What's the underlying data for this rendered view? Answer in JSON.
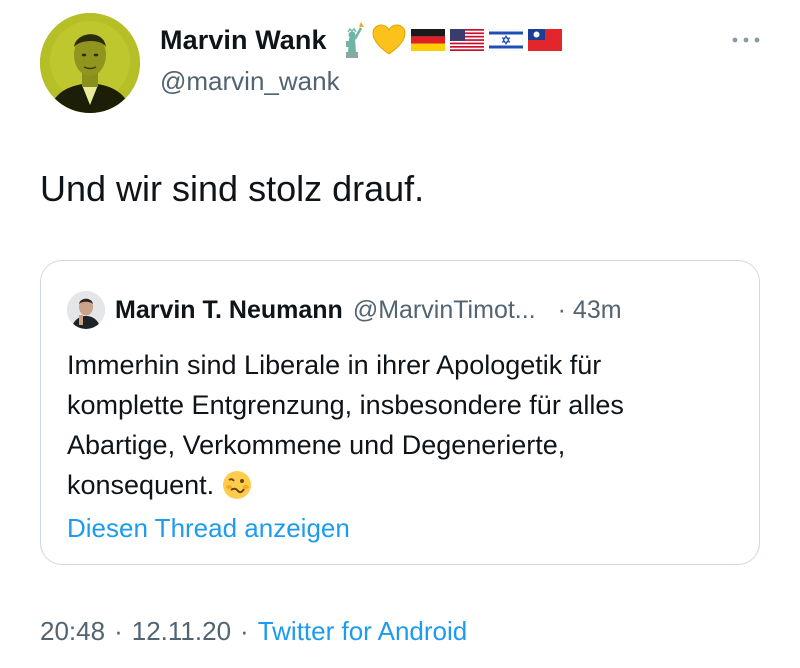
{
  "tweet": {
    "author": {
      "display_name": "Marvin Wank",
      "handle": "@marvin_wank",
      "name_emojis": [
        "statue-of-liberty-icon",
        "yellow-heart-icon",
        "flag-germany-icon",
        "flag-usa-icon",
        "flag-israel-icon",
        "flag-taiwan-icon"
      ]
    },
    "more_icon": "more-horizontal-icon",
    "text": "Und wir sind stolz drauf.",
    "quoted": {
      "display_name": "Marvin T. Neumann",
      "handle": "@MarvinTimot...",
      "time": "· 43m",
      "text_lines": [
        "Immerhin sind Liberale in ihrer Apologetik für",
        "komplette Entgrenzung, insbesondere für alles",
        "Abartige, Verkommene und Degenerierte,",
        "konsequent."
      ],
      "text_emoji": "woozy-face-icon",
      "show_thread_label": "Diesen Thread anzeigen"
    },
    "meta": {
      "time": "20:48",
      "separator": "·",
      "date": "12.11.20",
      "source": "Twitter for Android"
    }
  },
  "colors": {
    "text": "#0f1419",
    "secondary": "#536471",
    "link": "#1d9bf0",
    "border": "#cfd9de"
  }
}
